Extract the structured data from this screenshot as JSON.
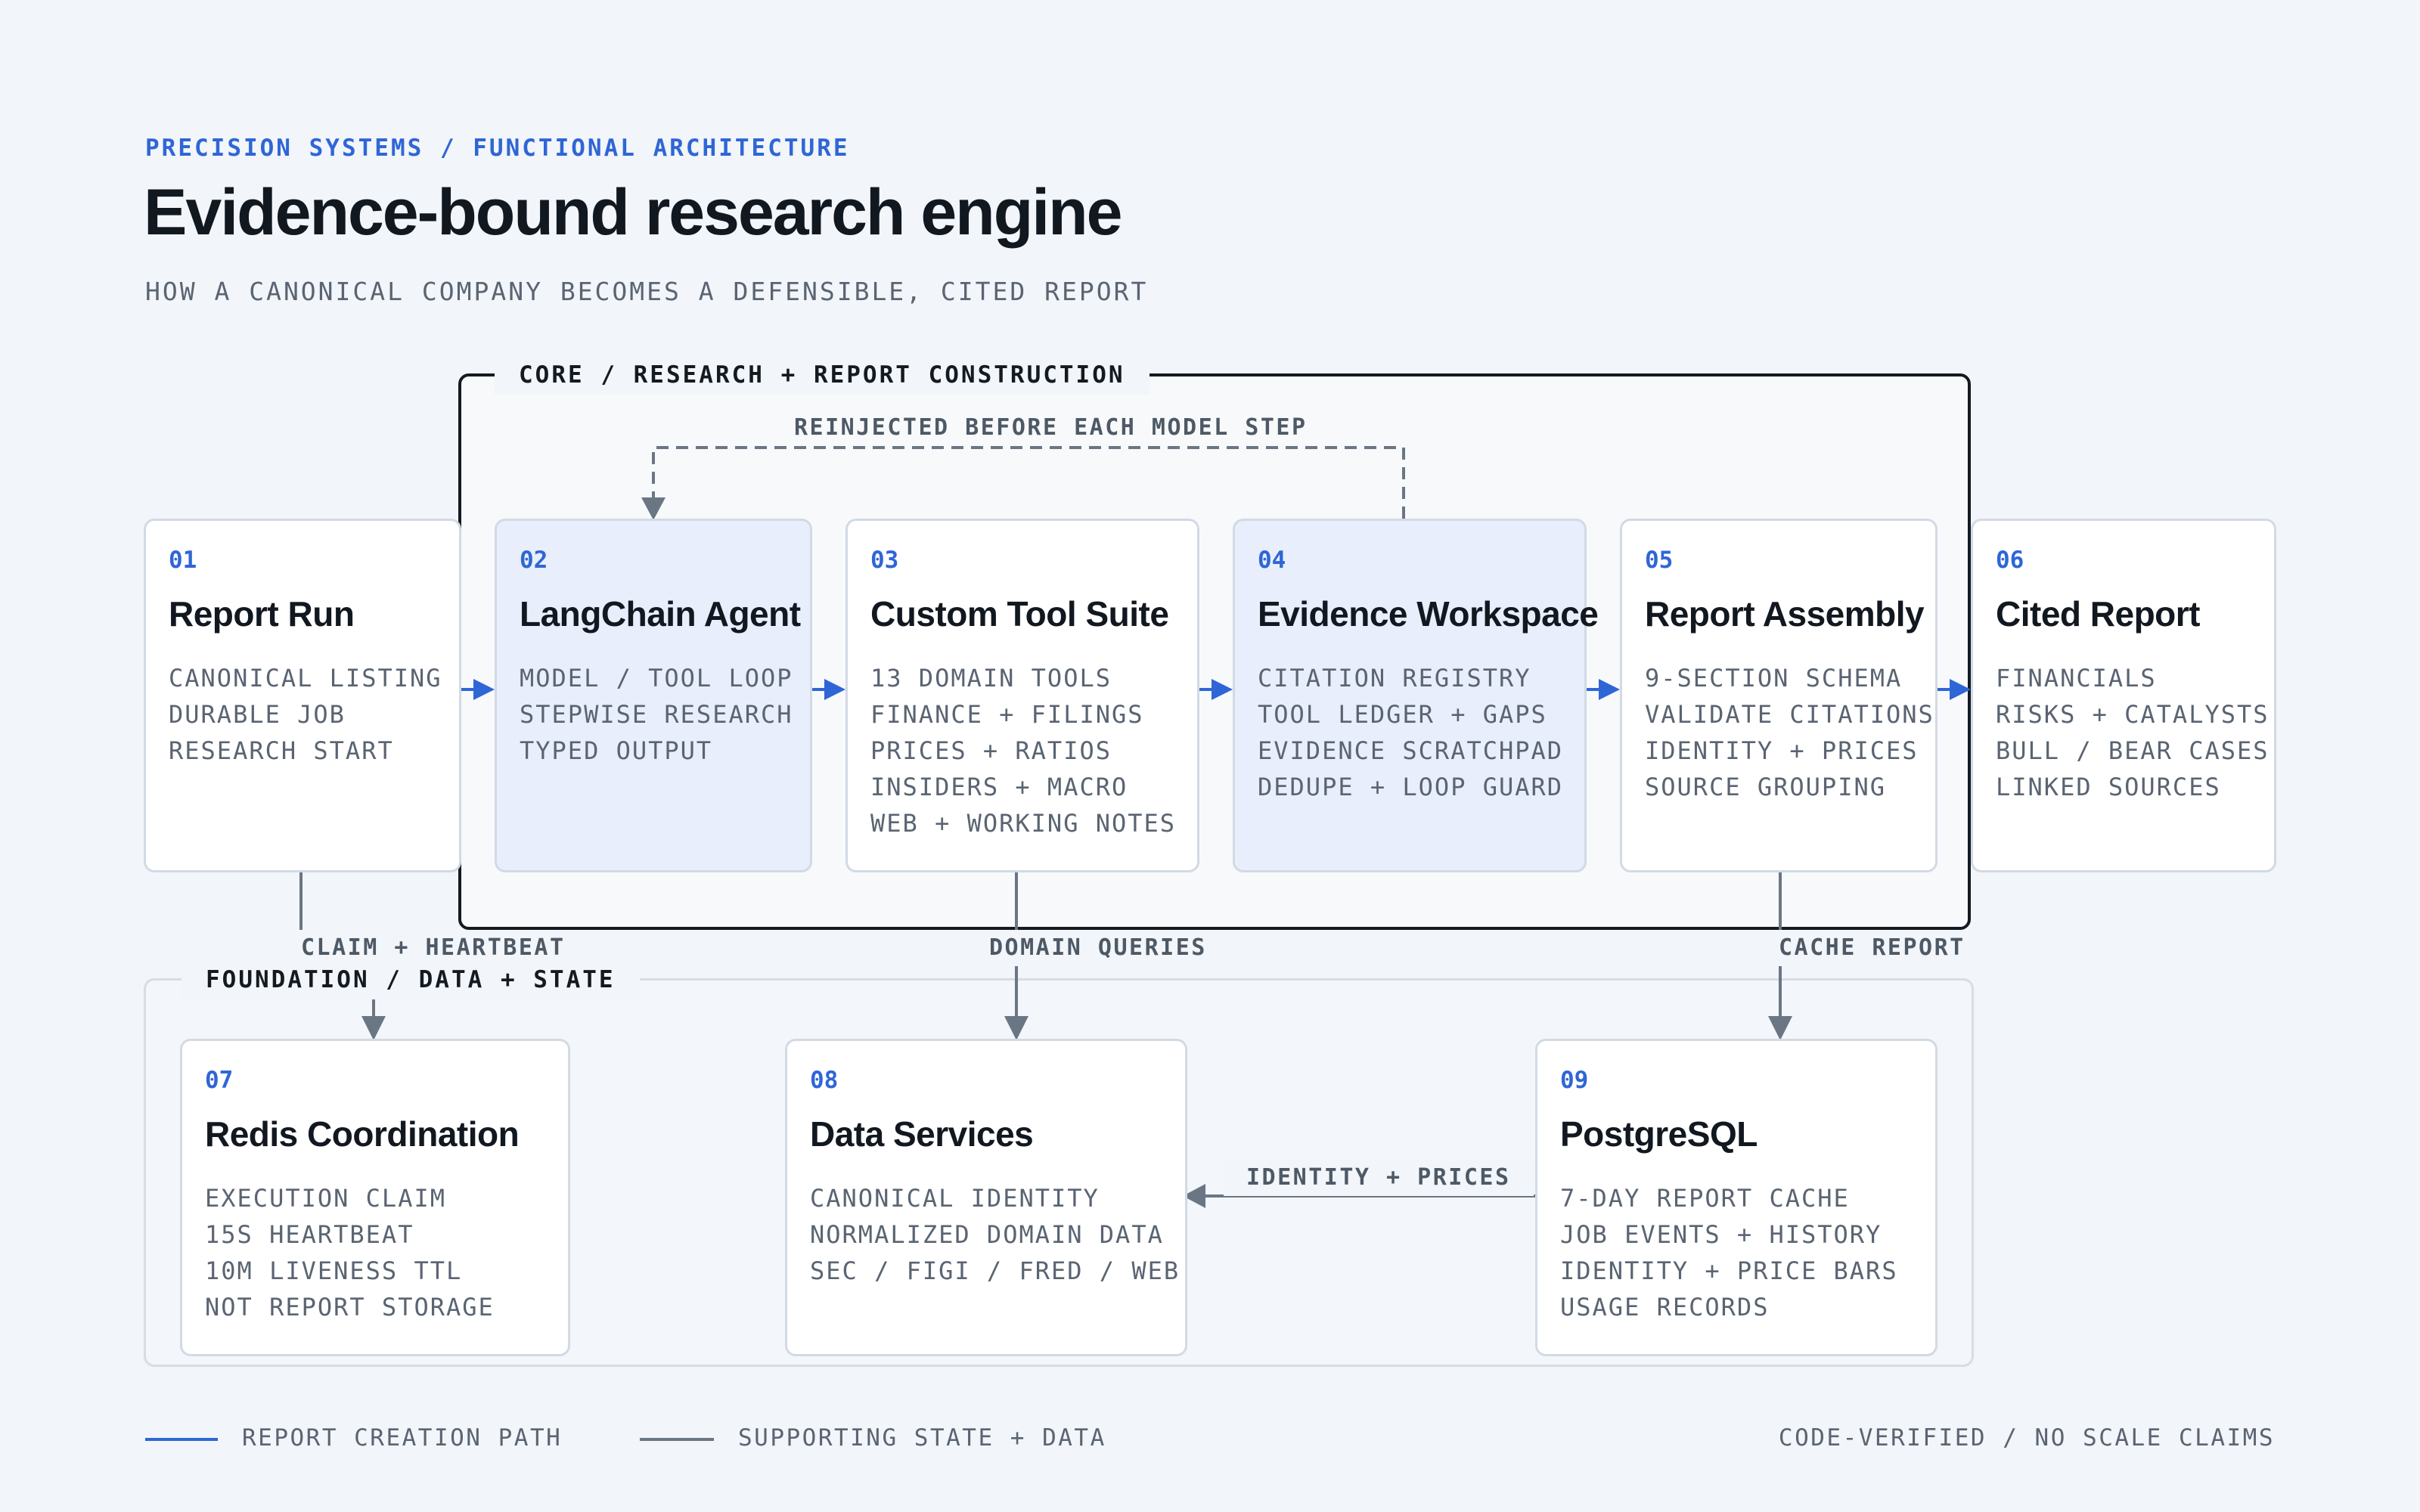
{
  "header": {
    "eyebrow": "PRECISION SYSTEMS / FUNCTIONAL ARCHITECTURE",
    "title": "Evidence-bound research engine",
    "subtitle": "HOW A CANONICAL COMPANY BECOMES A DEFENSIBLE, CITED REPORT"
  },
  "groups": {
    "core": "CORE / RESEARCH + REPORT CONSTRUCTION",
    "foundation": "FOUNDATION / DATA + STATE"
  },
  "cards": [
    {
      "num": "01",
      "name": "Report Run",
      "lines": [
        "CANONICAL LISTING",
        "DURABLE JOB",
        "RESEARCH START"
      ]
    },
    {
      "num": "02",
      "name": "LangChain Agent",
      "lines": [
        "MODEL / TOOL LOOP",
        "STEPWISE RESEARCH",
        "TYPED OUTPUT"
      ]
    },
    {
      "num": "03",
      "name": "Custom Tool Suite",
      "lines": [
        "13 DOMAIN TOOLS",
        "FINANCE + FILINGS",
        "PRICES + RATIOS",
        "INSIDERS + MACRO",
        "WEB + WORKING NOTES"
      ]
    },
    {
      "num": "04",
      "name": "Evidence Workspace",
      "lines": [
        "CITATION REGISTRY",
        "TOOL LEDGER + GAPS",
        "EVIDENCE SCRATCHPAD",
        "DEDUPE + LOOP GUARD"
      ]
    },
    {
      "num": "05",
      "name": "Report Assembly",
      "lines": [
        "9-SECTION SCHEMA",
        "VALIDATE CITATIONS",
        "IDENTITY + PRICES",
        "SOURCE GROUPING"
      ]
    },
    {
      "num": "06",
      "name": "Cited Report",
      "lines": [
        "FINANCIALS",
        "RISKS + CATALYSTS",
        "BULL / BEAR CASES",
        "LINKED SOURCES"
      ]
    },
    {
      "num": "07",
      "name": "Redis Coordination",
      "lines": [
        "EXECUTION CLAIM",
        "15S HEARTBEAT",
        "10M LIVENESS TTL",
        "NOT REPORT STORAGE"
      ]
    },
    {
      "num": "08",
      "name": "Data Services",
      "lines": [
        "CANONICAL IDENTITY",
        "NORMALIZED DOMAIN DATA",
        "SEC / FIGI / FRED / WEB"
      ]
    },
    {
      "num": "09",
      "name": "PostgreSQL",
      "lines": [
        "7-DAY REPORT CACHE",
        "JOB EVENTS + HISTORY",
        "IDENTITY + PRICE BARS",
        "USAGE RECORDS"
      ]
    }
  ],
  "edges": {
    "reinjected": "REINJECTED BEFORE EACH MODEL STEP",
    "claim": "CLAIM + HEARTBEAT",
    "domain": "DOMAIN QUERIES",
    "cache": "CACHE REPORT",
    "identity": "IDENTITY + PRICES"
  },
  "legend": {
    "primary": "REPORT CREATION PATH",
    "supporting": "SUPPORTING STATE + DATA",
    "note": "CODE-VERIFIED / NO SCALE CLAIMS"
  },
  "colors": {
    "accent": "#2f66d6",
    "supporting": "#6b7685",
    "highlight_card": "#e8eefb"
  }
}
